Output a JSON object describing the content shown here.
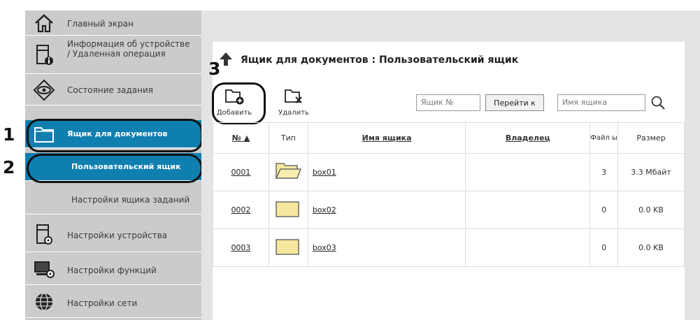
{
  "sidebar": {
    "items": [
      {
        "label": "Главный экран",
        "icon": "home-icon"
      },
      {
        "label": "Информация об устройстве / Удаленная операция",
        "icon": "device-info-icon"
      },
      {
        "label": "Состояние задания",
        "icon": "eye-icon"
      },
      {
        "label": "Ящик для документов",
        "icon": "folder-icon"
      },
      {
        "label": "Пользовательский ящик"
      },
      {
        "label": "Настройки ящика заданий"
      },
      {
        "label": "Настройки устройства",
        "icon": "device-settings-icon"
      },
      {
        "label": "Настройки функций",
        "icon": "function-settings-icon"
      },
      {
        "label": "Настройки сети",
        "icon": "globe-icon"
      }
    ]
  },
  "callouts": {
    "one": "1",
    "two": "2",
    "three": "3"
  },
  "page": {
    "title": "Ящик для документов : Пользовательский ящик"
  },
  "toolbar": {
    "add_label": "Добавить",
    "delete_label": "Удалить",
    "box_number_placeholder": "Ящик №",
    "go_label": "Перейти к",
    "box_name_placeholder": "Имя ящика"
  },
  "table": {
    "headers": {
      "number": "№",
      "type": "Тип",
      "name": "Имя ящика",
      "owner": "Владелец",
      "files": "Файл ы",
      "size": "Размер"
    },
    "rows": [
      {
        "number": "0001",
        "name": "box01",
        "owner": "",
        "files": "3",
        "size": "3.3 Мбайт",
        "open": true
      },
      {
        "number": "0002",
        "name": "box02",
        "owner": "",
        "files": "0",
        "size": "0.0 KB",
        "open": false
      },
      {
        "number": "0003",
        "name": "box03",
        "owner": "",
        "files": "0",
        "size": "0.0 KB",
        "open": false
      }
    ]
  },
  "colors": {
    "active": "#0f7fb0",
    "sidebar": "#cbcbcb",
    "main_bg": "#e4e4e4",
    "folder": "#f5e79e"
  }
}
